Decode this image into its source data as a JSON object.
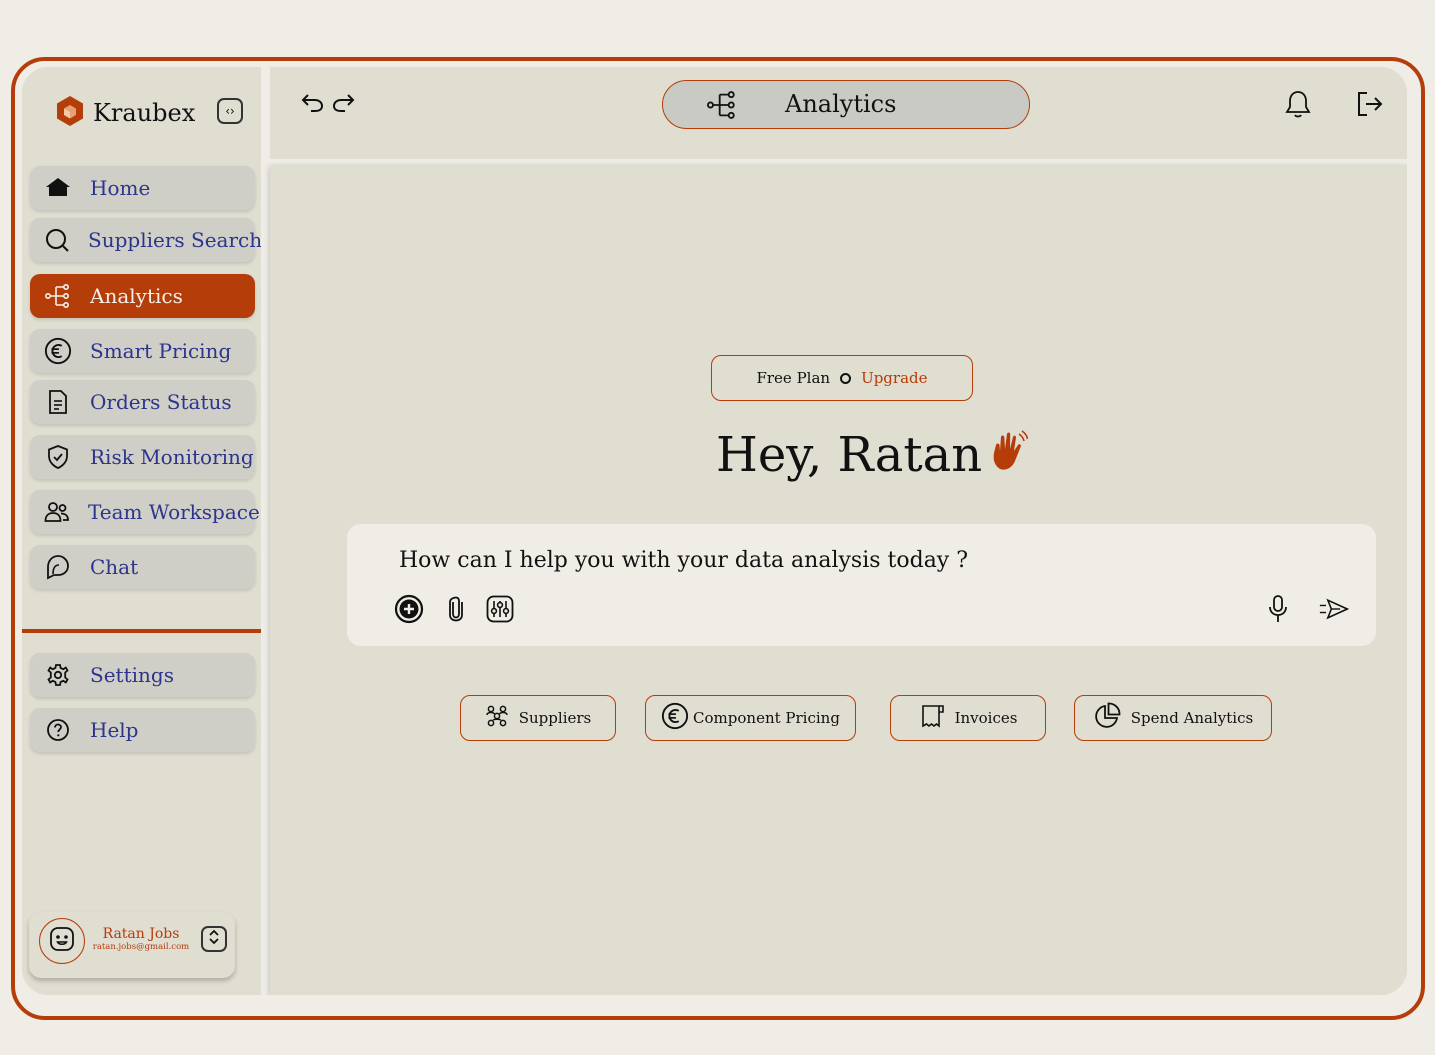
{
  "brand": {
    "name": "Kraubex",
    "accent": "#b53d0a"
  },
  "sidebar": {
    "items": [
      {
        "label": "Home",
        "icon": "home-icon"
      },
      {
        "label": "Suppliers Search",
        "icon": "search-icon"
      },
      {
        "label": "Analytics",
        "icon": "analytics-icon",
        "active": true
      },
      {
        "label": "Smart Pricing",
        "icon": "euro-icon"
      },
      {
        "label": "Orders Status",
        "icon": "document-icon"
      },
      {
        "label": "Risk Monitoring",
        "icon": "shield-icon"
      },
      {
        "label": "Team Workspace",
        "icon": "team-icon"
      },
      {
        "label": "Chat",
        "icon": "chat-icon"
      }
    ],
    "bottom_items": [
      {
        "label": "Settings",
        "icon": "gear-icon"
      },
      {
        "label": "Help",
        "icon": "help-icon"
      }
    ],
    "profile": {
      "name": "Ratan Jobs",
      "email": "ratan.jobs@gmail.com"
    }
  },
  "header": {
    "title": "Analytics"
  },
  "main": {
    "plan": {
      "label": "Free Plan",
      "upgrade": "Upgrade"
    },
    "greeting": "Hey, Ratan",
    "prompt_placeholder": "How can I help you with your data analysis today ?",
    "chips": [
      "Suppliers",
      "Component Pricing",
      "Invoices",
      "Spend Analytics"
    ]
  }
}
